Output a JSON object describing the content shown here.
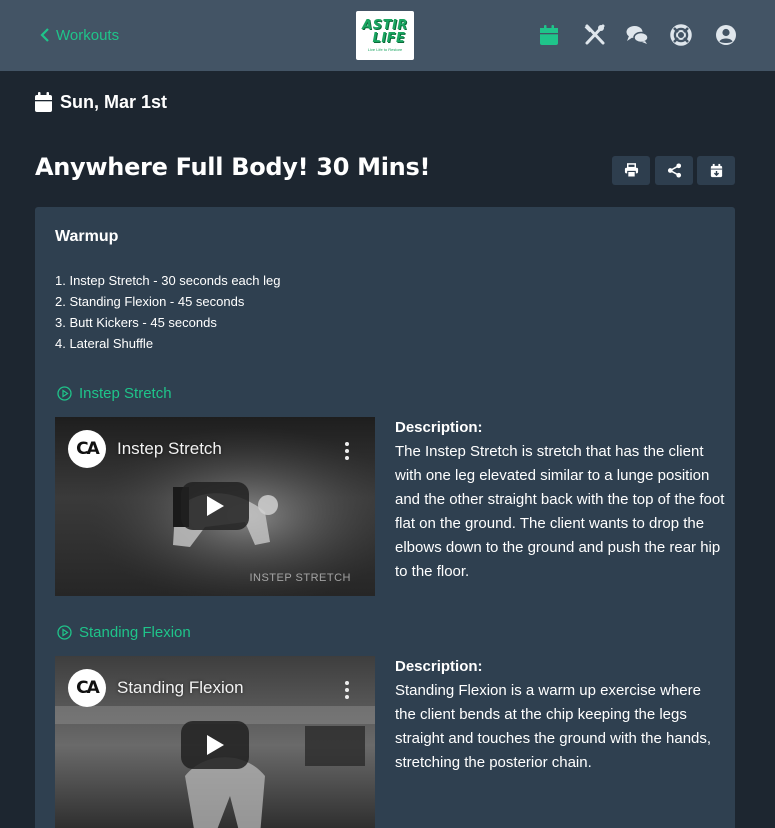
{
  "header": {
    "back_label": "Workouts",
    "logo": {
      "word1": "ASTIR",
      "word2": "LIFE",
      "tagline": "Live Life to Restore"
    },
    "nav_icons": [
      "calendar-icon",
      "utensils-icon",
      "chat-icon",
      "lifebuoy-icon",
      "user-circle-icon"
    ],
    "active_color": "#1fc48a",
    "icon_color": "#dfe6ec"
  },
  "date": "Sun, Mar 1st",
  "workout": {
    "title": "Anywhere Full Body! 30 Mins!",
    "actions": [
      "print-icon",
      "share-icon",
      "calendar-plus-icon"
    ]
  },
  "section": {
    "title": "Warmup",
    "steps": [
      "1. Instep Stretch - 30 seconds each leg",
      "2. Standing Flexion - 45 seconds",
      "3. Butt Kickers - 45 seconds",
      "4. Lateral Shuffle"
    ]
  },
  "exercises": [
    {
      "name": "Instep Stretch",
      "video_title": "Instep Stretch",
      "channel_logo": "CA",
      "video_caption": "INSTEP STRETCH",
      "description_label": "Description:",
      "description": "The Instep Stretch is stretch that has the client with one leg elevated similar to a lunge position and the other straight back with the top of the foot flat on the ground. The client wants to drop the elbows down to the ground and push the rear hip to the floor."
    },
    {
      "name": "Standing Flexion",
      "video_title": "Standing Flexion",
      "channel_logo": "CA",
      "description_label": "Description:",
      "description": "Standing Flexion is a warm up exercise where the client bends at the chip keeping the legs straight and touches the ground with the hands, stretching the posterior chain."
    }
  ],
  "colors": {
    "background": "#1d2630",
    "header": "#435465",
    "card": "#2f4050",
    "accent": "#1fc48a"
  }
}
